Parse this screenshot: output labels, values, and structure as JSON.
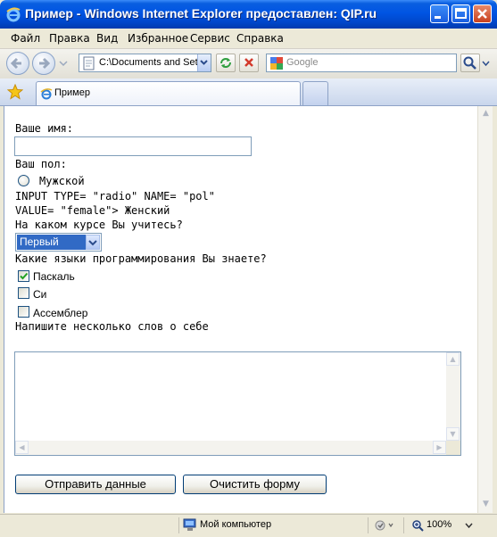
{
  "window": {
    "title": "Пример - Windows Internet Explorer предоставлен: QIP.ru"
  },
  "menu": [
    "Файл",
    "Правка",
    "Вид",
    "Избранное",
    "Сервис",
    "Справка"
  ],
  "address": {
    "value": "C:\\Documents and Set"
  },
  "search": {
    "placeholder": "Google"
  },
  "tab": {
    "label": "Пример"
  },
  "form": {
    "name_label": "Ваше имя:",
    "name_value": "",
    "gender_label": "Ваш пол:",
    "gender_option_male": "Мужской",
    "raw_line_1": "INPUT TYPE= \"radio\" NAME= \"pol\"",
    "raw_line_2": "VALUE= \"female\"> Женский",
    "course_label": "На каком курсе Вы учитесь?",
    "course_value": "Первый",
    "langs_label": "Какие языки программирования Вы знаете?",
    "langs": [
      {
        "label": "Паскаль",
        "checked": true
      },
      {
        "label": "Си",
        "checked": false
      },
      {
        "label": "Ассемблер",
        "checked": false
      }
    ],
    "about_label": "Напишите несколько слов о себе",
    "about_value": "",
    "submit_label": "Отправить данные",
    "reset_label": "Очистить форму"
  },
  "status": {
    "zone": "Мой компьютер",
    "zoom": "100%"
  }
}
